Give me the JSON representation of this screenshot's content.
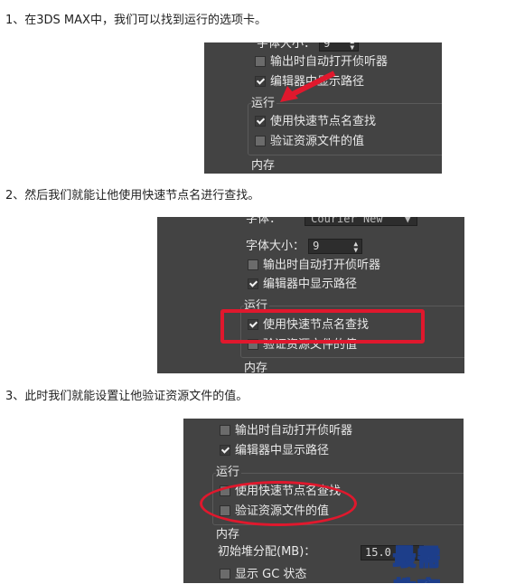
{
  "steps": [
    "1、在3DS MAX中，我们可以找到运行的选项卡。",
    "2、然后我们就能让他使用快速节点名进行查找。",
    "3、此时我们就能设置让他验证资源文件的值。"
  ],
  "panel1": {
    "font_size_label": "字体大小：",
    "font_size_value": "9",
    "output_autoopen": "输出时自动打开侦听器",
    "show_path": "编辑器中显示路径",
    "run_group": "运行",
    "quick_node": "使用快速节点名查找",
    "verify_res": "验证资源文件的值",
    "memory_group": "内存"
  },
  "panel2": {
    "font_label": "字体：",
    "font_value": "Courier New",
    "font_size_label": "字体大小：",
    "font_size_value": "9",
    "output_autoopen": "输出时自动打开侦听器",
    "show_path": "编辑器中显示路径",
    "run_group": "运行",
    "quick_node": "使用快速节点名查找",
    "verify_res": "验证资源文件的值",
    "memory_group": "内存"
  },
  "panel3": {
    "output_autoopen": "输出时自动打开侦听器",
    "show_path": "编辑器中显示路径",
    "run_group": "运行",
    "quick_node": "使用快速节点名查找",
    "verify_res": "验证资源文件的值",
    "memory_group": "内存",
    "initial_heap_label": "初始堆分配(MB)：",
    "initial_heap_value": "15.0",
    "show_gc": "显示 GC 状态"
  },
  "watermark": "最需教育",
  "colors": {
    "panel_bg": "#434343",
    "annotation_red": "#e0182d",
    "watermark_blue": "#1d3e8a"
  }
}
